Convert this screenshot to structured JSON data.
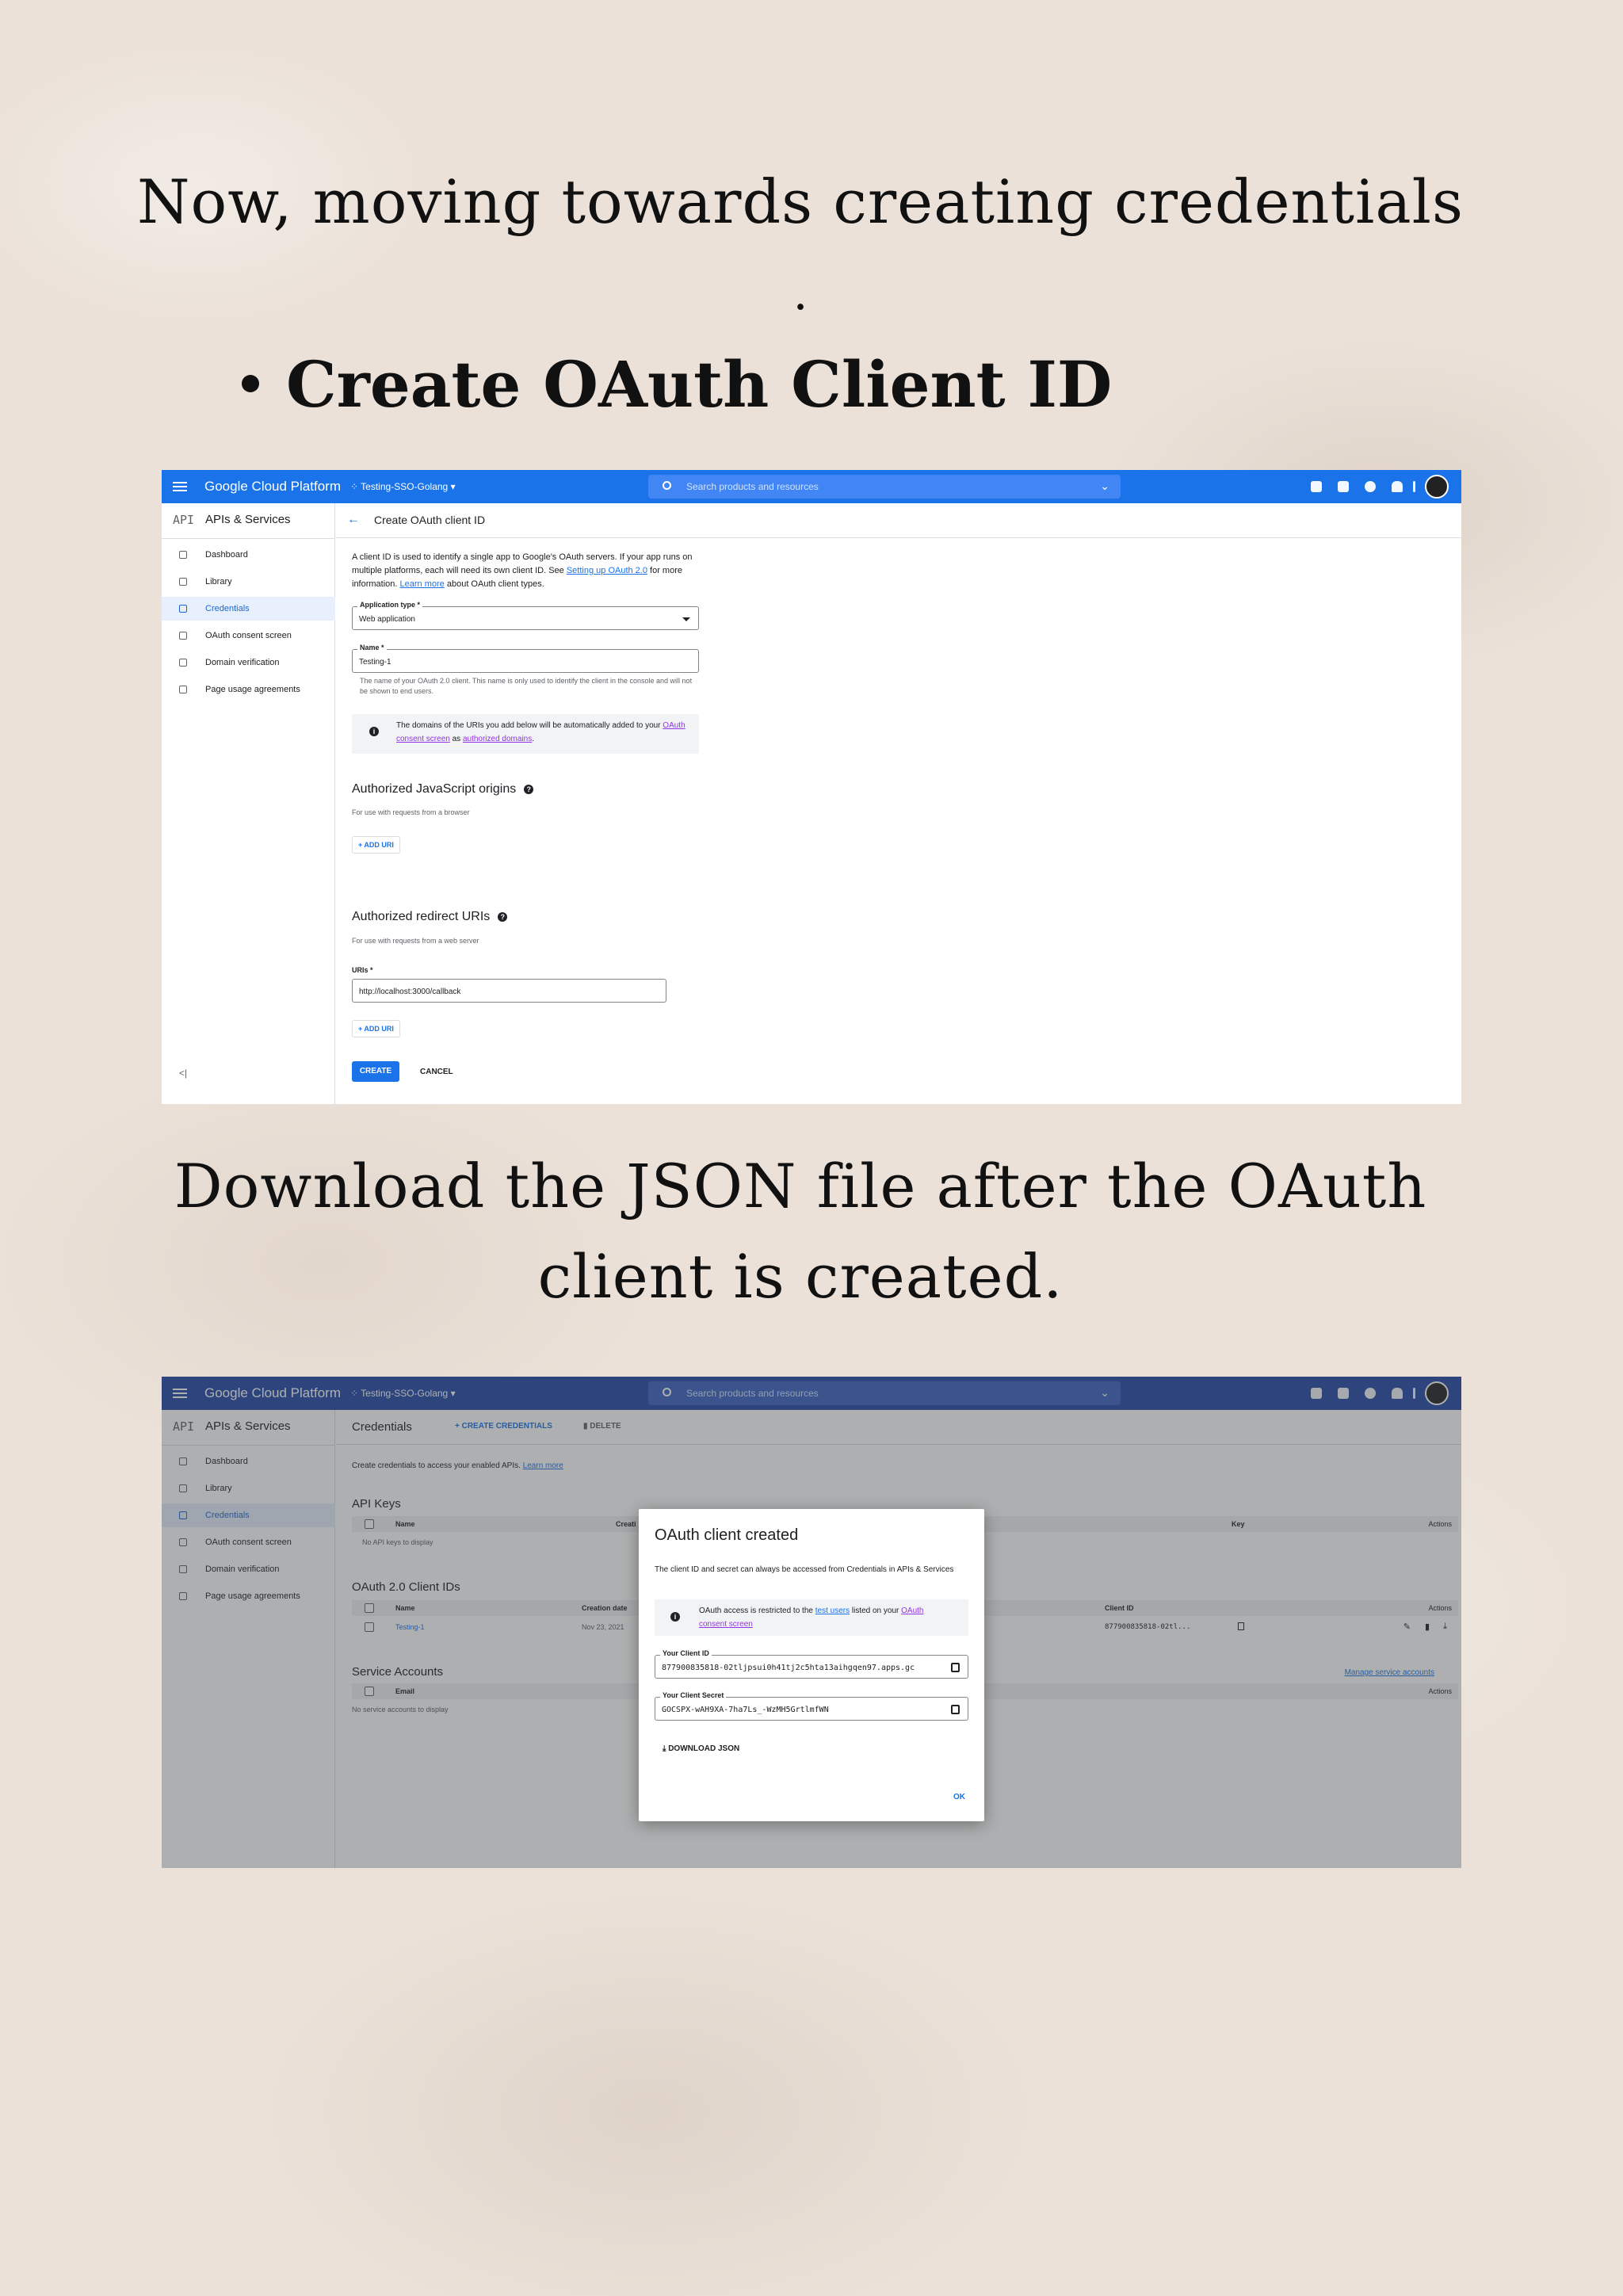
{
  "headings": {
    "intro": "Now, moving towards creating credentials",
    "intro_dot": ".",
    "bullet": "Create OAuth Client ID",
    "download": "Download the JSON file after the OAuth client is created."
  },
  "colors": {
    "gcp_blue": "#1a73e8",
    "topbar_dim": "#2348a6",
    "active_bg": "#e8f0fe",
    "page_bg": "#ebe1d8"
  },
  "topbar": {
    "brand": "Google Cloud Platform",
    "project": "Testing-SSO-Golang",
    "search_placeholder": "Search products and resources",
    "icons": [
      "menu-icon",
      "gift-icon",
      "terminal-icon",
      "help-icon",
      "bell-icon",
      "more-vert-icon",
      "avatar"
    ]
  },
  "sidebar": {
    "api_logo": "API",
    "title": "APIs & Services",
    "items": [
      {
        "label": "Dashboard",
        "icon": "dashboard-icon"
      },
      {
        "label": "Library",
        "icon": "library-icon"
      },
      {
        "label": "Credentials",
        "icon": "key-icon"
      },
      {
        "label": "OAuth consent screen",
        "icon": "consent-icon"
      },
      {
        "label": "Domain verification",
        "icon": "domain-icon"
      },
      {
        "label": "Page usage agreements",
        "icon": "agreements-icon"
      }
    ],
    "collapse": "<|"
  },
  "create_form": {
    "page_title": "Create OAuth client ID",
    "intro_1": "A client ID is used to identify a single app to Google's OAuth servers. If your app runs on multiple platforms, each will need its own client ID. See ",
    "intro_link_1": "Setting up OAuth 2.0",
    "intro_2": " for more information. ",
    "intro_link_2": "Learn more",
    "intro_3": " about OAuth client types.",
    "app_type_label": "Application type *",
    "app_type_value": "Web application",
    "name_label": "Name *",
    "name_value": "Testing-1",
    "name_help": "The name of your OAuth 2.0 client. This name is only used to identify the client in the console and will not be shown to end users.",
    "info_1": "The domains of the URIs you add below will be automatically added to your ",
    "info_link_1": "OAuth consent screen",
    "info_2": " as ",
    "info_link_2": "authorized domains",
    "info_3": ".",
    "js_origins_title": "Authorized JavaScript origins",
    "js_origins_help": "For use with requests from a browser",
    "add_uri": "+ ADD URI",
    "redirect_title": "Authorized redirect URIs",
    "redirect_help": "For use with requests from a web server",
    "uris_label": "URIs *",
    "uri_value": "http://localhost:3000/callback",
    "create": "CREATE",
    "cancel": "CANCEL"
  },
  "credentials": {
    "page_title": "Credentials",
    "create_credentials": "+ CREATE CREDENTIALS",
    "delete": "DELETE",
    "intro": "Create credentials to access your enabled APIs. ",
    "intro_link": "Learn more",
    "api_keys_title": "API Keys",
    "api_keys_cols": {
      "name": "Name",
      "creation": "Creati",
      "key": "Key",
      "actions": "Actions"
    },
    "api_keys_empty": "No API keys to display",
    "oauth_title": "OAuth 2.0 Client IDs",
    "oauth_cols": {
      "name": "Name",
      "creation": "Creation date",
      "client_id": "Client ID",
      "actions": "Actions"
    },
    "oauth_row": {
      "name": "Testing-1",
      "date": "Nov 23, 2021",
      "client_id": "877900835818-02tl..."
    },
    "service_title": "Service Accounts",
    "manage_link": "Manage service accounts",
    "service_cols": {
      "email": "Email",
      "actions": "Actions"
    },
    "service_empty": "No service accounts to display"
  },
  "dialog": {
    "title": "OAuth client created",
    "desc": "The client ID and secret can always be accessed from Credentials in APIs & Services",
    "info_1": "OAuth access is restricted to the ",
    "info_link_1": "test users",
    "info_2": " listed on your ",
    "info_link_2": "OAuth consent screen",
    "client_id_label": "Your Client ID",
    "client_id_value": "877900835818-02tljpsui0h41tj2c5hta13aihgqen97.apps.gc",
    "secret_label": "Your Client Secret",
    "secret_value": "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",
    "download": "DOWNLOAD JSON",
    "ok": "OK"
  }
}
